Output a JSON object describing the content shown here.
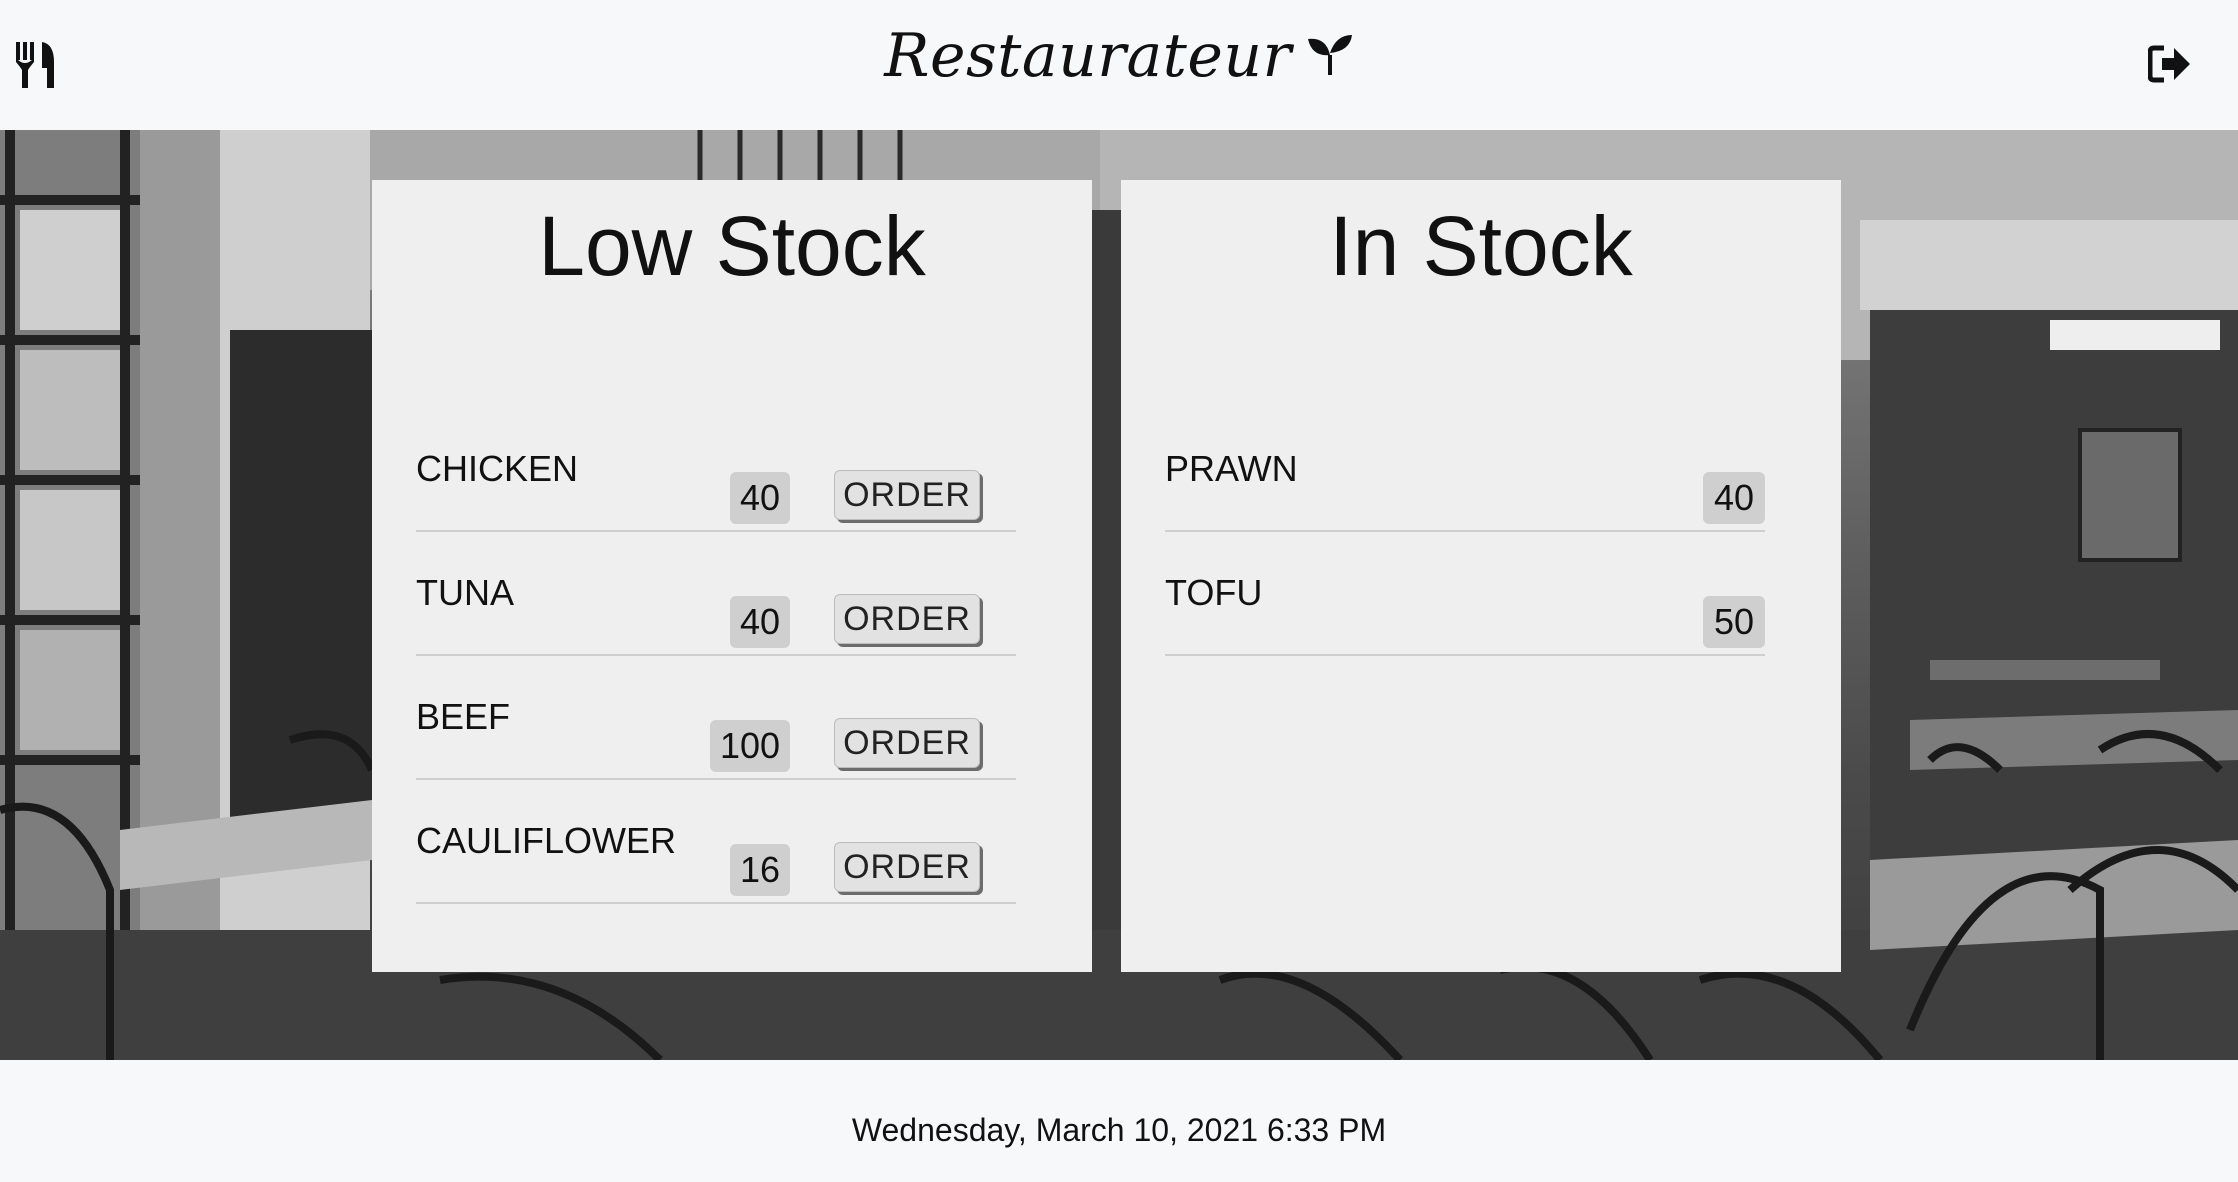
{
  "header": {
    "brand": "Restaurateur",
    "left_icon": "fork-knife-icon",
    "brand_icon": "leaf-icon",
    "right_icon": "logout-icon"
  },
  "panels": {
    "low": {
      "title": "Low Stock",
      "items": [
        {
          "name": "CHICKEN",
          "qty": "40",
          "action": "ORDER"
        },
        {
          "name": "TUNA",
          "qty": "40",
          "action": "ORDER"
        },
        {
          "name": "BEEF",
          "qty": "100",
          "action": "ORDER"
        },
        {
          "name": "CAULIFLOWER",
          "qty": "16",
          "action": "ORDER"
        }
      ]
    },
    "in": {
      "title": "In Stock",
      "items": [
        {
          "name": "PRAWN",
          "qty": "40"
        },
        {
          "name": "TOFU",
          "qty": "50"
        }
      ]
    }
  },
  "footer": {
    "datetime": "Wednesday, March 10, 2021 6:33 PM"
  },
  "colors": {
    "panel": "#efefef",
    "badge": "#cfcfcf",
    "page": "#f7f8fa"
  }
}
